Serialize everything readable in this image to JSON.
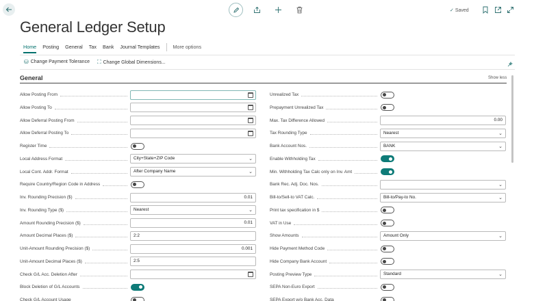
{
  "page": {
    "title": "General Ledger Setup",
    "saved_label": "Saved"
  },
  "icons": {
    "back": "arrow-left",
    "edit": "pencil",
    "share": "share",
    "new": "plus",
    "delete": "trash",
    "bookmark": "bookmark",
    "open_new": "open-in-new-window",
    "expand": "expand",
    "personalize": "sparkle-settings"
  },
  "colors": {
    "accent": "#00706c",
    "toggle_on": "#0e7b78"
  },
  "tabs": [
    {
      "label": "Home",
      "active": true
    },
    {
      "label": "Posting"
    },
    {
      "label": "General"
    },
    {
      "label": "Tax"
    },
    {
      "label": "Bank"
    },
    {
      "label": "Journal Templates"
    }
  ],
  "more_options": "More options",
  "actions": [
    {
      "label": "Change Payment Tolerance"
    },
    {
      "label": "Change Global Dimensions..."
    }
  ],
  "section": {
    "title": "General",
    "show_less": "Show less"
  },
  "left_fields": [
    {
      "label": "Allow Posting From",
      "type": "date",
      "value": ""
    },
    {
      "label": "Allow Posting To",
      "type": "date",
      "value": ""
    },
    {
      "label": "Allow Deferral Posting From",
      "type": "date",
      "value": ""
    },
    {
      "label": "Allow Deferral Posting To",
      "type": "date",
      "value": ""
    },
    {
      "label": "Register Time",
      "type": "toggle",
      "on": false
    },
    {
      "label": "Local Address Format",
      "type": "select",
      "value": "City+State+ZIP Code"
    },
    {
      "label": "Local Cont. Addr. Format",
      "type": "select",
      "value": "After Company Name"
    },
    {
      "label": "Require Country/Region Code in Address",
      "type": "toggle",
      "on": false
    },
    {
      "label": "Inv. Rounding Precision ($)",
      "type": "number",
      "value": "0.01"
    },
    {
      "label": "Inv. Rounding Type ($)",
      "type": "select",
      "value": "Nearest"
    },
    {
      "label": "Amount Rounding Precision ($)",
      "type": "number",
      "value": "0.01"
    },
    {
      "label": "Amount Decimal Places ($)",
      "type": "text",
      "value": "2:2"
    },
    {
      "label": "Unit-Amount Rounding Precision ($)",
      "type": "number",
      "value": "0.001"
    },
    {
      "label": "Unit-Amount Decimal Places ($)",
      "type": "text",
      "value": "2:5"
    },
    {
      "label": "Check G/L Acc. Deletion After",
      "type": "date",
      "value": ""
    },
    {
      "label": "Block Deletion of G/L Accounts",
      "type": "toggle",
      "on": true
    },
    {
      "label": "Check G/L Account Usage",
      "type": "toggle",
      "on": false
    }
  ],
  "right_fields": [
    {
      "label": "Unrealized Tax",
      "type": "toggle",
      "on": false
    },
    {
      "label": "Prepayment Unrealized Tax",
      "type": "toggle",
      "on": false
    },
    {
      "label": "Max. Tax Difference Allowed",
      "type": "number",
      "value": "0.00"
    },
    {
      "label": "Tax Rounding Type",
      "type": "select",
      "value": "Nearest"
    },
    {
      "label": "Bank Account Nos.",
      "type": "select",
      "value": "BANK"
    },
    {
      "label": "Enable Withholding Tax",
      "type": "toggle",
      "on": true
    },
    {
      "label": "Min. Withholding Tax Calc only on Inv. Amt",
      "type": "toggle",
      "on": true
    },
    {
      "label": "Bank Rec. Adj. Doc. Nos.",
      "type": "select",
      "value": ""
    },
    {
      "label": "Bill-to/Sell-to VAT Calc.",
      "type": "select",
      "value": "Bill-to/Pay-to No."
    },
    {
      "label": "Print tax specification in $",
      "type": "toggle",
      "on": false
    },
    {
      "label": "VAT in Use",
      "type": "toggle",
      "on": false
    },
    {
      "label": "Show Amounts",
      "type": "select",
      "value": "Amount Only"
    },
    {
      "label": "Hide Payment Method Code",
      "type": "toggle",
      "on": false
    },
    {
      "label": "Hide Company Bank Account",
      "type": "toggle",
      "on": false
    },
    {
      "label": "Posting Preview Type",
      "type": "select",
      "value": "Standard"
    },
    {
      "label": "SEPA Non-Euro Export",
      "type": "toggle",
      "on": false
    },
    {
      "label": "SEPA Export w/o Bank Acc. Data",
      "type": "toggle",
      "on": false
    }
  ]
}
